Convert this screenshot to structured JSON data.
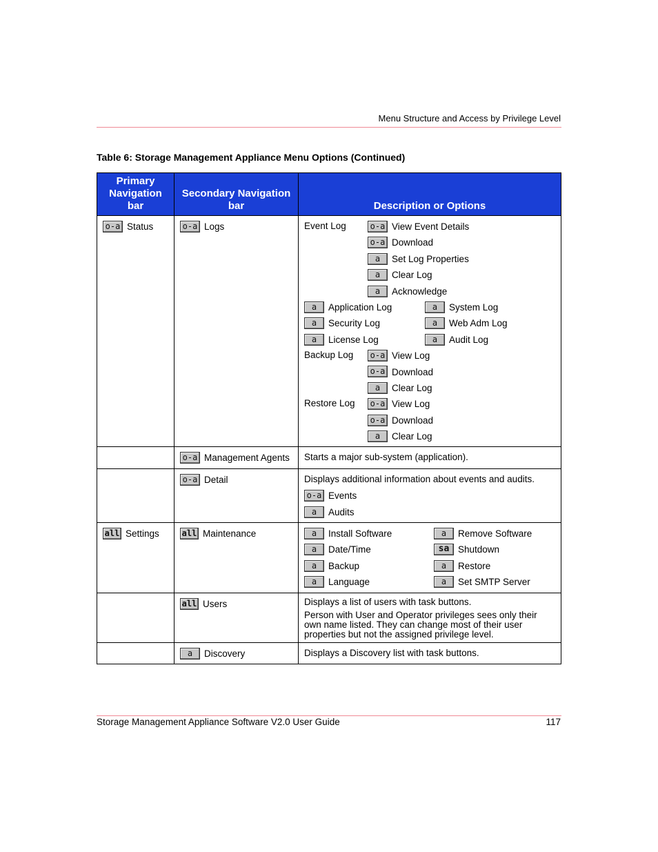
{
  "header": {
    "running_title": "Menu Structure and Access by Privilege Level"
  },
  "caption": "Table 6:  Storage Management Appliance Menu Options (Continued)",
  "table": {
    "headers": [
      "Primary Navigation bar",
      "Secondary Navigation bar",
      "Description or Options"
    ],
    "rows": {
      "status_logs": {
        "primary": {
          "badge": "o-a",
          "label": "Status"
        },
        "secondary": {
          "badge": "o-a",
          "label": "Logs"
        },
        "event_log": {
          "label": "Event Log",
          "items": [
            {
              "badge": "o-a",
              "label": "View Event Details"
            },
            {
              "badge": "a",
              "label": "Download",
              "badge_override": "o-a"
            },
            {
              "badge": "a",
              "label": "Set Log Properties"
            },
            {
              "badge": "a",
              "label": "Clear Log"
            },
            {
              "badge": "a",
              "label": "Acknowledge"
            }
          ]
        },
        "log_types": [
          {
            "badge": "a",
            "label": "Application Log"
          },
          {
            "badge": "a",
            "label": "System Log"
          },
          {
            "badge": "a",
            "label": "Security Log"
          },
          {
            "badge": "a",
            "label": "Web Adm Log"
          },
          {
            "badge": "a",
            "label": "License Log"
          },
          {
            "badge": "a",
            "label": "Audit Log"
          }
        ],
        "backup_log": {
          "label": "Backup Log",
          "items": [
            {
              "badge": "o-a",
              "label": "View Log"
            },
            {
              "badge": "o-a",
              "label": "Download"
            },
            {
              "badge": "a",
              "label": "Clear Log"
            }
          ]
        },
        "restore_log": {
          "label": "Restore Log",
          "items": [
            {
              "badge": "o-a",
              "label": "View Log"
            },
            {
              "badge": "o-a",
              "label": "Download"
            },
            {
              "badge": "a",
              "label": "Clear Log"
            }
          ]
        }
      },
      "management_agents": {
        "secondary": {
          "badge": "o-a",
          "label": "Management Agents"
        },
        "description": "Starts a major sub-system (application)."
      },
      "detail": {
        "secondary": {
          "badge": "o-a",
          "label": "Detail"
        },
        "description": "Displays additional information about events and audits.",
        "items": [
          {
            "badge": "o-a",
            "label": "Events"
          },
          {
            "badge": "a",
            "label": "Audits"
          }
        ]
      },
      "settings_maintenance": {
        "primary": {
          "badge": "all",
          "label": "Settings"
        },
        "secondary": {
          "badge": "all",
          "label": "Maintenance"
        },
        "items": [
          {
            "badge": "a",
            "label": "Install Software"
          },
          {
            "badge": "a",
            "label": "Remove Software"
          },
          {
            "badge": "a",
            "label": "Date/Time"
          },
          {
            "badge": "sa",
            "label": "Shutdown"
          },
          {
            "badge": "a",
            "label": "Backup"
          },
          {
            "badge": "a",
            "label": "Restore"
          },
          {
            "badge": "a",
            "label": "Language"
          },
          {
            "badge": "a",
            "label": "Set SMTP Server"
          }
        ]
      },
      "users": {
        "secondary": {
          "badge": "all",
          "label": "Users"
        },
        "description": "Displays a list of users with task buttons.",
        "note": "Person with User and Operator privileges sees only their own name listed. They can change most of their user properties but not the assigned privilege level."
      },
      "discovery": {
        "secondary": {
          "badge": "a",
          "label": "Discovery"
        },
        "description": "Displays a Discovery list with task buttons."
      }
    }
  },
  "footer": {
    "title": "Storage Management Appliance Software V2.0 User Guide",
    "page_number": "117"
  }
}
